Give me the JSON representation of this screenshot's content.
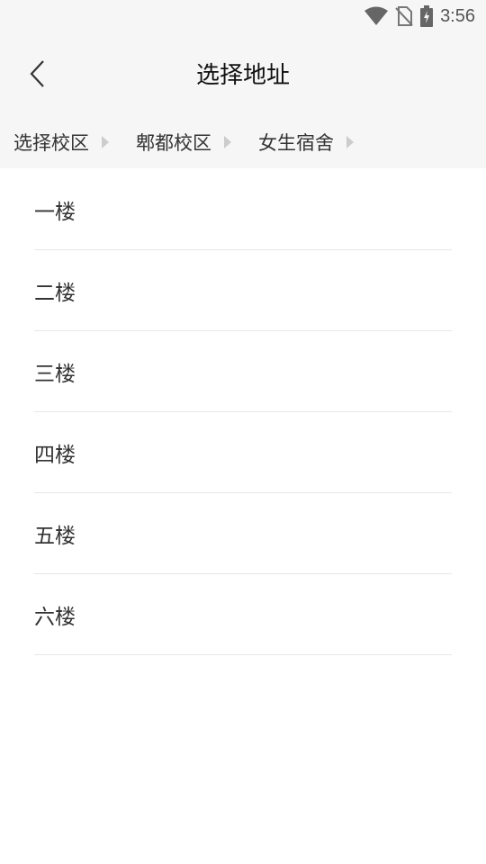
{
  "status_bar": {
    "time": "3:56",
    "icons": [
      "wifi-icon",
      "no-sim-icon",
      "battery-charging-icon"
    ]
  },
  "header": {
    "title": "选择地址",
    "back_icon": "chevron-left-icon"
  },
  "breadcrumb": {
    "items": [
      {
        "label": "选择校区"
      },
      {
        "label": "郫都校区"
      },
      {
        "label": "女生宿舍"
      }
    ]
  },
  "floors": {
    "items": [
      {
        "label": "一楼"
      },
      {
        "label": "二楼"
      },
      {
        "label": "三楼"
      },
      {
        "label": "四楼"
      },
      {
        "label": "五楼"
      },
      {
        "label": "六楼"
      }
    ]
  },
  "colors": {
    "header_bg": "#f6f6f6",
    "text": "#333333",
    "divider": "#e8e8e8",
    "arrow": "#cccccc"
  }
}
